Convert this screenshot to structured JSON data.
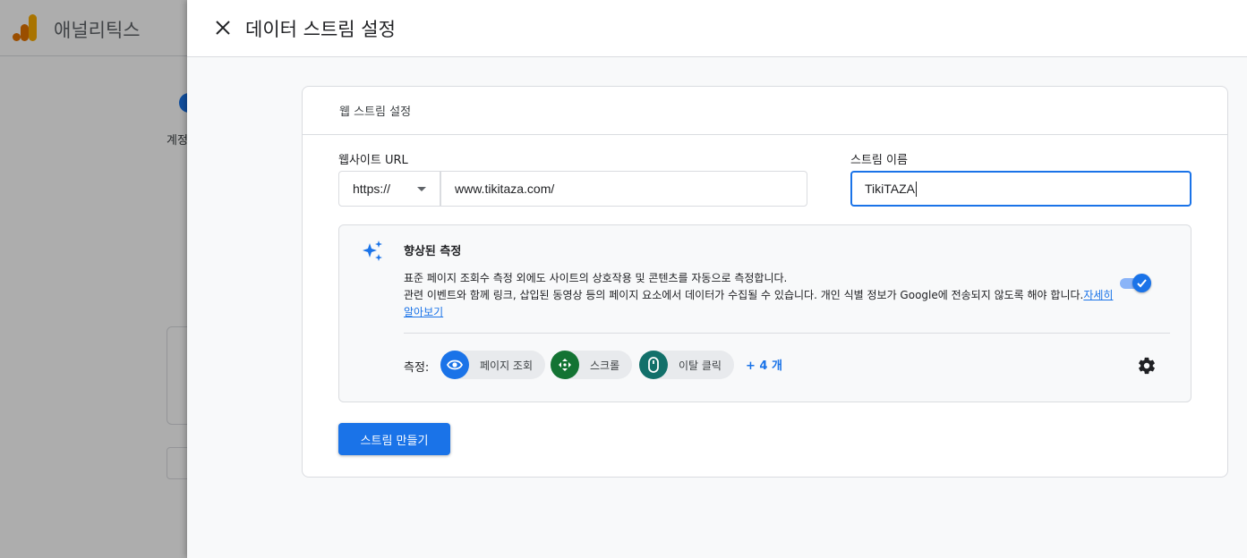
{
  "background_app": {
    "title": "애널리틱스",
    "step_label": "계정"
  },
  "drawer": {
    "title": "데이터 스트림 설정",
    "close_icon": "close-icon"
  },
  "card": {
    "heading": "웹 스트림 설정",
    "website_url": {
      "label": "웹사이트 URL",
      "protocol": "https://",
      "value": "www.tikitaza.com/"
    },
    "stream_name": {
      "label": "스트림 이름",
      "value": "TikiTAZA"
    },
    "enhanced_measurement": {
      "title": "향상된 측정",
      "description_line1": "표준 페이지 조회수 측정 외에도 사이트의 상호작용 및 콘텐츠를 자동으로 측정합니다.",
      "description_line2": "관련 이벤트와 함께 링크, 삽입된 동영상 등의 페이지 요소에서 데이터가 수집될 수 있습니다. 개인 식별 정보가 Google에 전송되지 않도록 해야 합니다.",
      "learn_more": "자세히 알아보기",
      "enabled": true,
      "measurements_label": "측정:",
      "chips": [
        {
          "label": "페이지 조회",
          "icon": "eye-icon",
          "color": "#1a73e8"
        },
        {
          "label": "스크롤",
          "icon": "scroll-arrows-icon",
          "color": "#137333"
        },
        {
          "label": "이탈 클릭",
          "icon": "mouse-icon",
          "color": "#12706a"
        }
      ],
      "more_link": "+ 4 개"
    },
    "create_button": "스트림 만들기"
  },
  "colors": {
    "primary": "#1a73e8",
    "toggle_track": "#8ab4f8"
  }
}
